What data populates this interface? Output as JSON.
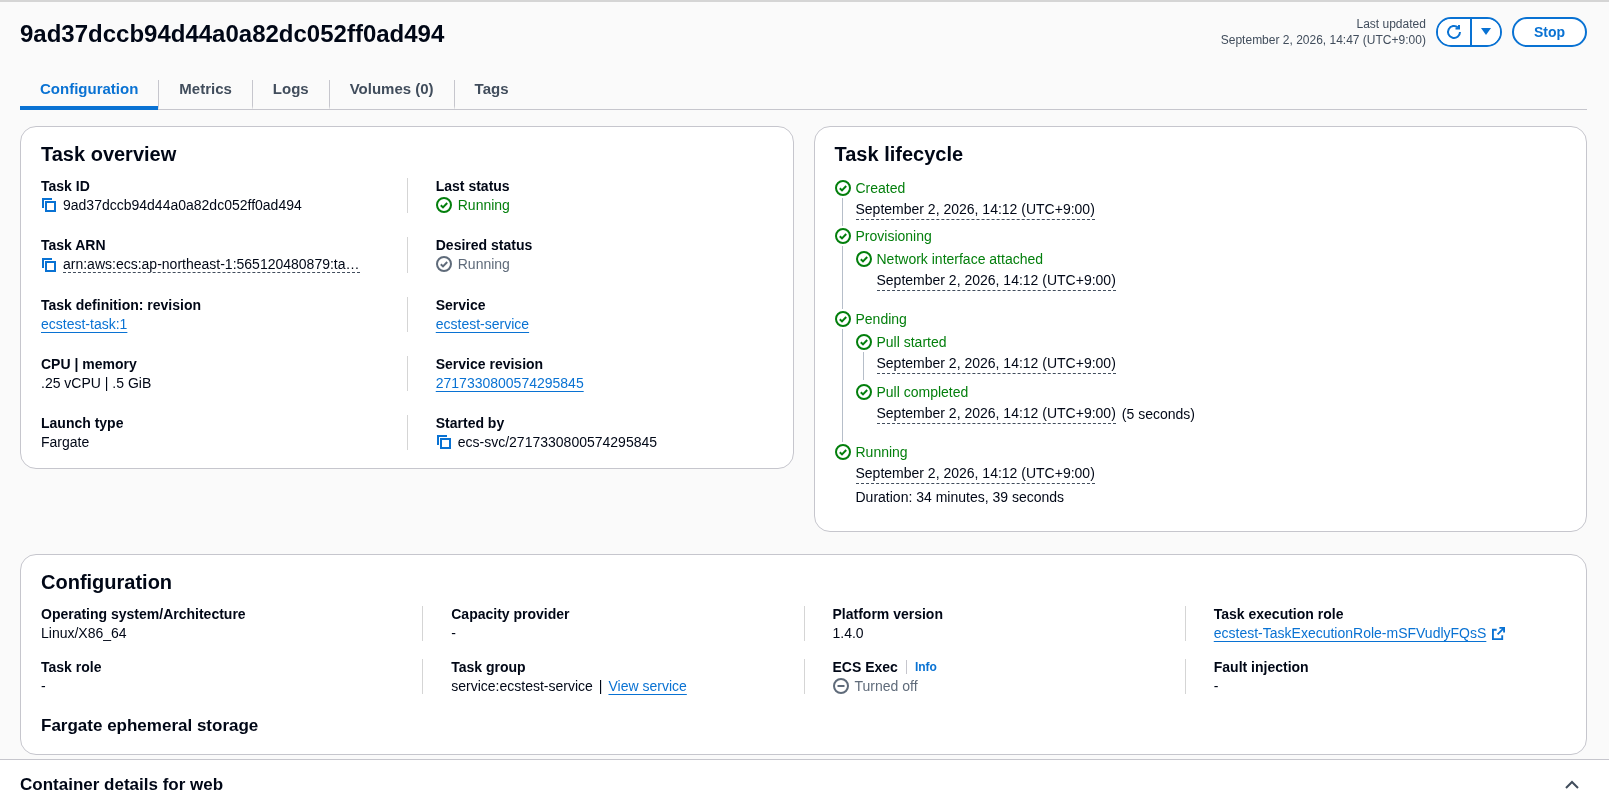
{
  "header": {
    "title": "9ad37dccb94d44a0a82dc052ff0ad494",
    "last_updated_label": "Last updated",
    "last_updated_value": "September 2, 2026, 14:47 (UTC+9:00)",
    "stop_button": "Stop"
  },
  "tabs": [
    {
      "label": "Configuration",
      "selected": true
    },
    {
      "label": "Metrics",
      "selected": false
    },
    {
      "label": "Logs",
      "selected": false
    },
    {
      "label": "Volumes (0)",
      "selected": false
    },
    {
      "label": "Tags",
      "selected": false
    }
  ],
  "task_overview": {
    "title": "Task overview",
    "rows": [
      [
        {
          "label": "Task ID",
          "kind": "copy",
          "value": "9ad37dccb94d44a0a82dc052ff0ad494"
        },
        {
          "label": "Last status",
          "kind": "status",
          "active": true,
          "value": "Running"
        }
      ],
      [
        {
          "label": "Task ARN",
          "kind": "copy-truncated",
          "value": "arn:aws:ecs:ap-northeast-1:565120480879:ta…"
        },
        {
          "label": "Desired status",
          "kind": "status",
          "active": false,
          "value": "Running"
        }
      ],
      [
        {
          "label": "Task definition: revision",
          "kind": "link",
          "value": "ecstest-task:1"
        },
        {
          "label": "Service",
          "kind": "link",
          "value": "ecstest-service"
        }
      ],
      [
        {
          "label": "CPU | memory",
          "kind": "text",
          "value": ".25 vCPU | .5 GiB"
        },
        {
          "label": "Service revision",
          "kind": "link",
          "value": "2717330800574295845"
        }
      ],
      [
        {
          "label": "Launch type",
          "kind": "text",
          "value": "Fargate"
        },
        {
          "label": "Started by",
          "kind": "copy",
          "value": "ecs-svc/2717330800574295845"
        }
      ]
    ]
  },
  "task_lifecycle": {
    "title": "Task lifecycle",
    "events": [
      {
        "label": "Created",
        "time": "September 2, 2026, 14:12 (UTC+9:00)"
      },
      {
        "label": "Provisioning",
        "children": [
          {
            "label": "Network interface attached",
            "time": "September 2, 2026, 14:12 (UTC+9:00)"
          }
        ]
      },
      {
        "label": "Pending",
        "children": [
          {
            "label": "Pull started",
            "time": "September 2, 2026, 14:12 (UTC+9:00)"
          },
          {
            "label": "Pull completed",
            "time": "September 2, 2026, 14:12 (UTC+9:00)",
            "extra": "(5 seconds)"
          }
        ]
      },
      {
        "label": "Running",
        "time": "September 2, 2026, 14:12 (UTC+9:00)",
        "duration": "Duration: 34 minutes, 39 seconds"
      }
    ]
  },
  "configuration": {
    "title": "Configuration",
    "rows": [
      [
        {
          "label": "Operating system/Architecture",
          "kind": "text",
          "value": "Linux/X86_64"
        },
        {
          "label": "Capacity provider",
          "kind": "text",
          "value": "-"
        },
        {
          "label": "Platform version",
          "kind": "text",
          "value": "1.4.0"
        },
        {
          "label": "Task execution role",
          "kind": "external-link",
          "value": "ecstest-TaskExecutionRole-mSFVudlyFQsS"
        }
      ],
      [
        {
          "label": "Task role",
          "kind": "text",
          "value": "-"
        },
        {
          "label": "Task group",
          "kind": "text-link",
          "value": "service:ecstest-service",
          "separator": "|",
          "link": "View service"
        },
        {
          "label": "ECS Exec",
          "info": "Info",
          "kind": "status-off",
          "value": "Turned off"
        },
        {
          "label": "Fault injection",
          "kind": "text",
          "value": "-"
        }
      ]
    ],
    "subheading": "Fargate ephemeral storage"
  },
  "bottom_panel": {
    "title": "Container details for web"
  }
}
